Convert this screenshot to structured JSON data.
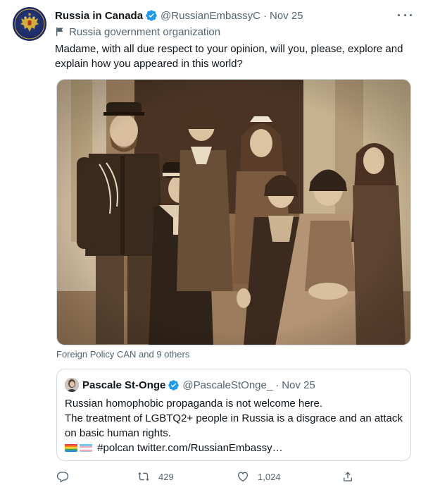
{
  "tweet": {
    "display_name": "Russia in Canada",
    "handle": "@RussianEmbassyC",
    "separator": "·",
    "time": "Nov 25",
    "affiliation": "Russia government organization",
    "text": "Madame, with all due respect to your opinion, will you, please, explore and explain how you appeared in this world?",
    "tagged": "Foreign Policy CAN and 9 others",
    "accent_color": "#1d9bf0"
  },
  "quote": {
    "display_name": "Pascale St-Onge",
    "handle": "@PascaleStOnge_",
    "separator": "·",
    "time": "Nov 25",
    "line1": "Russian homophobic propaganda is not welcome here.",
    "line2": "The treatment of LGBTQ2+ people in Russia is a disgrace and an attack on basic human rights.",
    "line3": "#polcan twitter.com/RussianEmbassy…",
    "emoji": [
      "rainbow-flag",
      "transgender-flag"
    ]
  },
  "actions": {
    "reply": {
      "icon": "reply-icon",
      "count": ""
    },
    "retweet": {
      "icon": "retweet-icon",
      "count": "429"
    },
    "like": {
      "icon": "heart-icon",
      "count": "1,024"
    },
    "share": {
      "icon": "share-icon",
      "count": ""
    }
  }
}
